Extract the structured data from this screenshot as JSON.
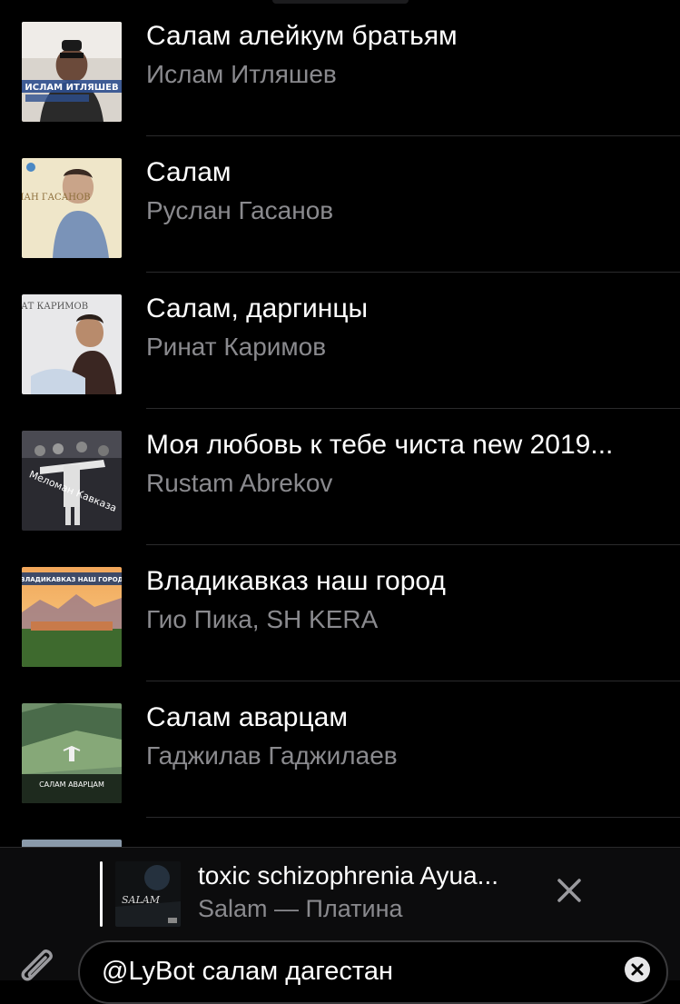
{
  "results": [
    {
      "title": "Салам алейкум братьям",
      "artist": "Ислам Итляшев",
      "cover_icon": "album-cover-islam-itlyashev",
      "cover_text": "ИСЛАМ ИТЛЯШЕВ"
    },
    {
      "title": "Салам",
      "artist": "Руслан Гасанов",
      "cover_icon": "album-cover-ruslan-gasanov",
      "cover_text": "РУСЛАН ГАСАНОВ"
    },
    {
      "title": "Салам, даргинцы",
      "artist": "Ринат Каримов",
      "cover_icon": "album-cover-rinat-karimov",
      "cover_text": "РИНАТ КАРИМОВ"
    },
    {
      "title": "Моя любовь к тебе чиста new 2019...",
      "artist": "Rustam Abrekov",
      "cover_icon": "album-cover-rustam-abrekov",
      "cover_text": "Меломан Кавказа"
    },
    {
      "title": "Владикавказ наш город",
      "artist": "Гио Пика, SH KERA",
      "cover_icon": "album-cover-vladikavkaz",
      "cover_text": "ВЛАДИКАВКАЗ НАШ ГОРОД"
    },
    {
      "title": "Салам аварцам",
      "artist": "Гаджилав Гаджилаев",
      "cover_icon": "album-cover-salam-avarcam",
      "cover_text": "САЛАМ АВАРЦАМ"
    }
  ],
  "reply": {
    "title": "toxic schizophrenia Ayua...",
    "subtitle": "Salam — Платина",
    "cover_icon": "album-cover-salam",
    "cover_text": "SALAM"
  },
  "composer": {
    "text": "@LyBot салам дагестан"
  },
  "colors": {
    "background": "#000000",
    "primary_text": "#ffffff",
    "secondary_text": "#8a8a8e",
    "separator": "#2a2a2c"
  },
  "icons": {
    "reply_close": "close-icon",
    "attach": "paperclip-icon",
    "clear": "clear-icon"
  }
}
